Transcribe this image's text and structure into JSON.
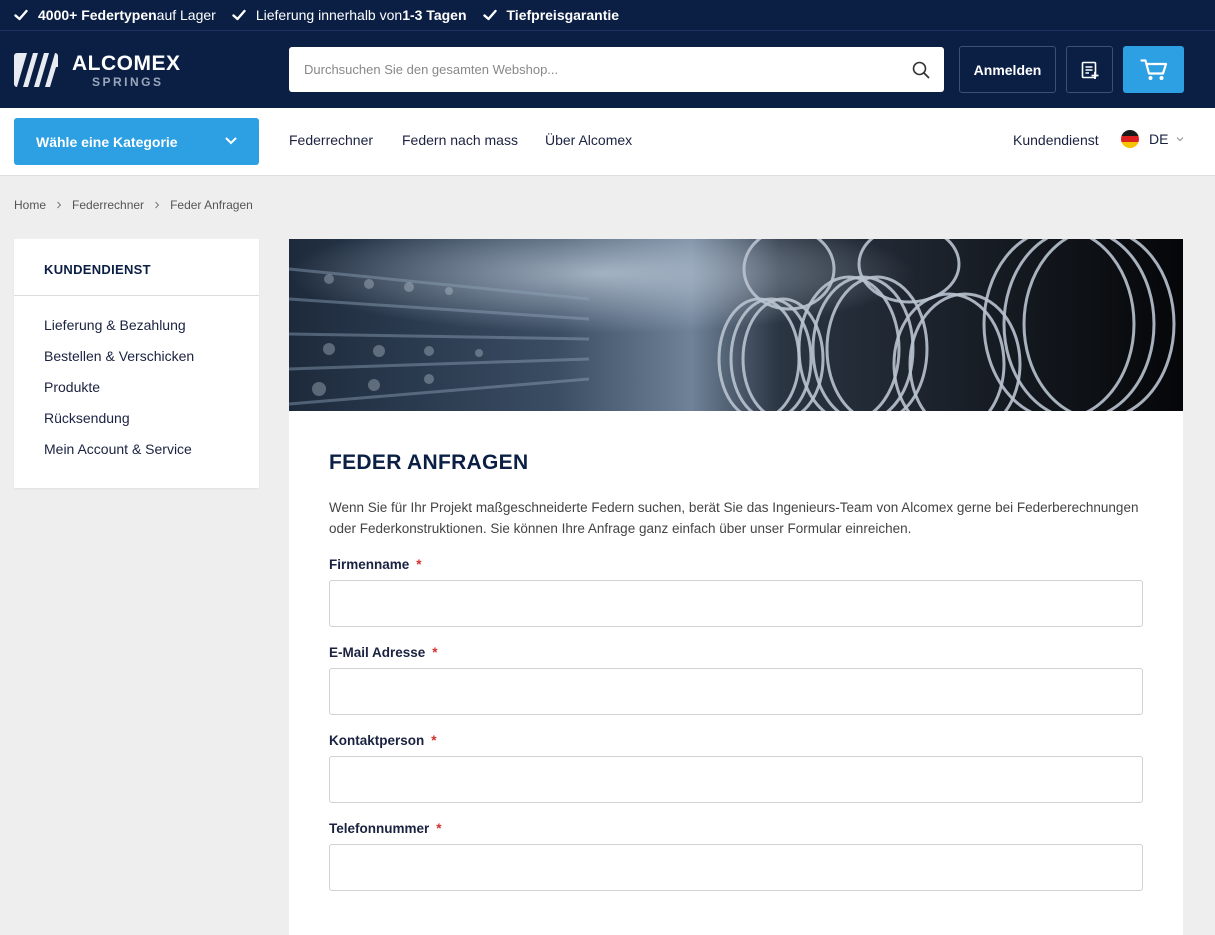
{
  "usp": [
    {
      "bold": "4000+ Federtypen",
      "rest": " auf Lager"
    },
    {
      "norm": "Lieferung innerhalb von ",
      "bold": "1-3 Tagen"
    },
    {
      "bold": "Tiefpreisgarantie"
    }
  ],
  "logo": {
    "main": "ALCOMEX",
    "sub": "SPRINGS"
  },
  "search": {
    "placeholder": "Durchsuchen Sie den gesamten Webshop..."
  },
  "header": {
    "login_label": "Anmelden"
  },
  "nav": {
    "category_button": "Wähle eine Kategorie",
    "links": [
      "Federrechner",
      "Federn nach mass",
      "Über Alcomex"
    ],
    "service": "Kundendienst",
    "language": "DE"
  },
  "breadcrumb": [
    "Home",
    "Federrechner",
    "Feder Anfragen"
  ],
  "sidebar": {
    "title": "KUNDENDIENST",
    "items": [
      "Lieferung & Bezahlung",
      "Bestellen & Verschicken",
      "Produkte",
      "Rücksendung",
      "Mein Account & Service"
    ]
  },
  "main": {
    "title": "FEDER ANFRAGEN",
    "intro": "Wenn Sie für Ihr Projekt maßgeschneiderte Federn suchen, berät Sie das Ingenieurs-Team von Alcomex gerne bei Federberechnungen oder Federkonstruktionen. Sie können Ihre Anfrage ganz einfach über unser Formular einreichen."
  },
  "form": {
    "fields": [
      {
        "label": "Firmenname",
        "required_mark": "*",
        "value": ""
      },
      {
        "label": "E-Mail Adresse",
        "required_mark": "*",
        "value": ""
      },
      {
        "label": "Kontaktperson",
        "required_mark": "*",
        "value": ""
      },
      {
        "label": "Telefonnummer",
        "required_mark": "*",
        "value": ""
      }
    ]
  },
  "colors": {
    "navy": "#0b1f45",
    "accent": "#2d9fe3",
    "required": "#d0312d"
  }
}
